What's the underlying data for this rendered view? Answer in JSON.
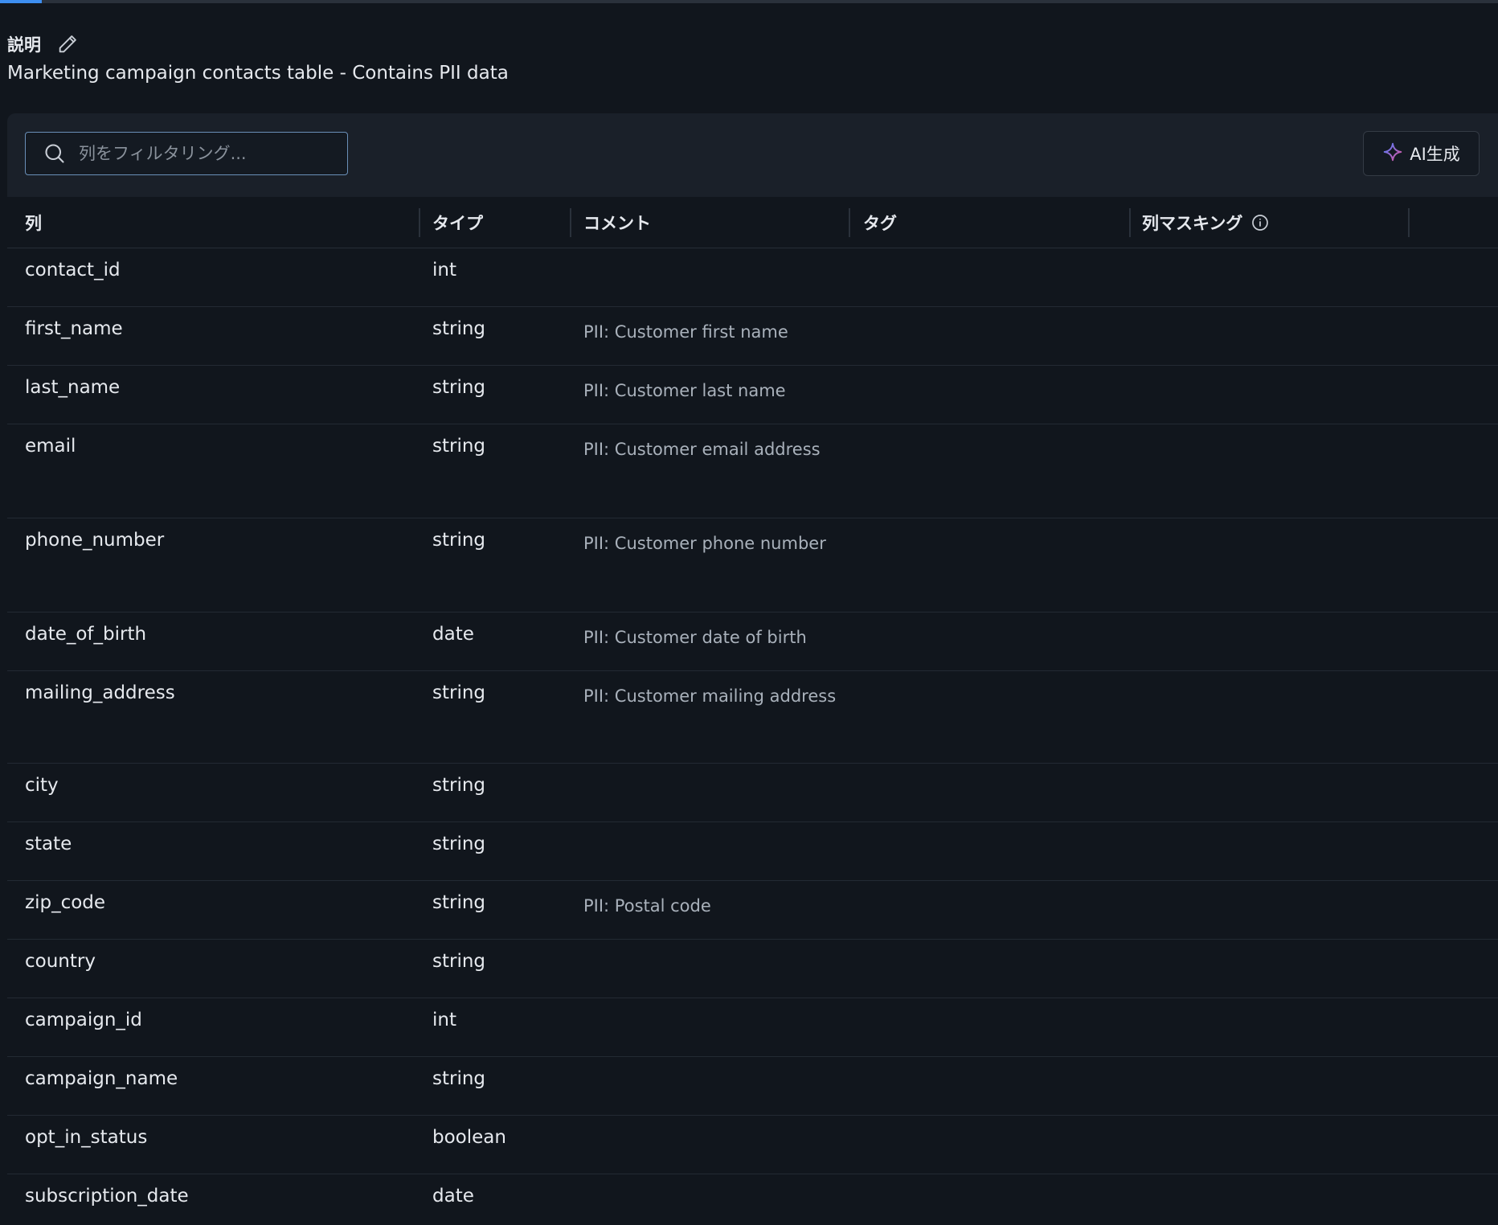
{
  "description": {
    "label": "説明",
    "text": "Marketing campaign contacts table - Contains PII data"
  },
  "toolbar": {
    "search_placeholder": "列をフィルタリング...",
    "ai_button_label": "AI生成"
  },
  "table": {
    "headers": {
      "column": "列",
      "type": "タイプ",
      "comment": "コメント",
      "tags": "タグ",
      "masking": "列マスキング"
    },
    "rows": [
      {
        "name": "contact_id",
        "type": "int",
        "comment": ""
      },
      {
        "name": "first_name",
        "type": "string",
        "comment": "PII: Customer first name"
      },
      {
        "name": "last_name",
        "type": "string",
        "comment": "PII: Customer last name"
      },
      {
        "name": "email",
        "type": "string",
        "comment": "PII: Customer email address"
      },
      {
        "name": "phone_number",
        "type": "string",
        "comment": "PII: Customer phone number"
      },
      {
        "name": "date_of_birth",
        "type": "date",
        "comment": "PII: Customer date of birth"
      },
      {
        "name": "mailing_address",
        "type": "string",
        "comment": "PII: Customer mailing address"
      },
      {
        "name": "city",
        "type": "string",
        "comment": ""
      },
      {
        "name": "state",
        "type": "string",
        "comment": ""
      },
      {
        "name": "zip_code",
        "type": "string",
        "comment": "PII: Postal code"
      },
      {
        "name": "country",
        "type": "string",
        "comment": ""
      },
      {
        "name": "campaign_id",
        "type": "int",
        "comment": ""
      },
      {
        "name": "campaign_name",
        "type": "string",
        "comment": ""
      },
      {
        "name": "opt_in_status",
        "type": "boolean",
        "comment": ""
      },
      {
        "name": "subscription_date",
        "type": "date",
        "comment": ""
      }
    ]
  },
  "icons": {
    "edit": "pencil-icon",
    "search": "search-icon",
    "ai": "sparkle-icon",
    "info": "info-icon"
  },
  "colors": {
    "background": "#11161d",
    "toolbar": "#1a2029",
    "active_tab": "#3d8ef0",
    "ai_sparkle_start": "#4f7cff",
    "ai_sparkle_end": "#e0559b"
  }
}
